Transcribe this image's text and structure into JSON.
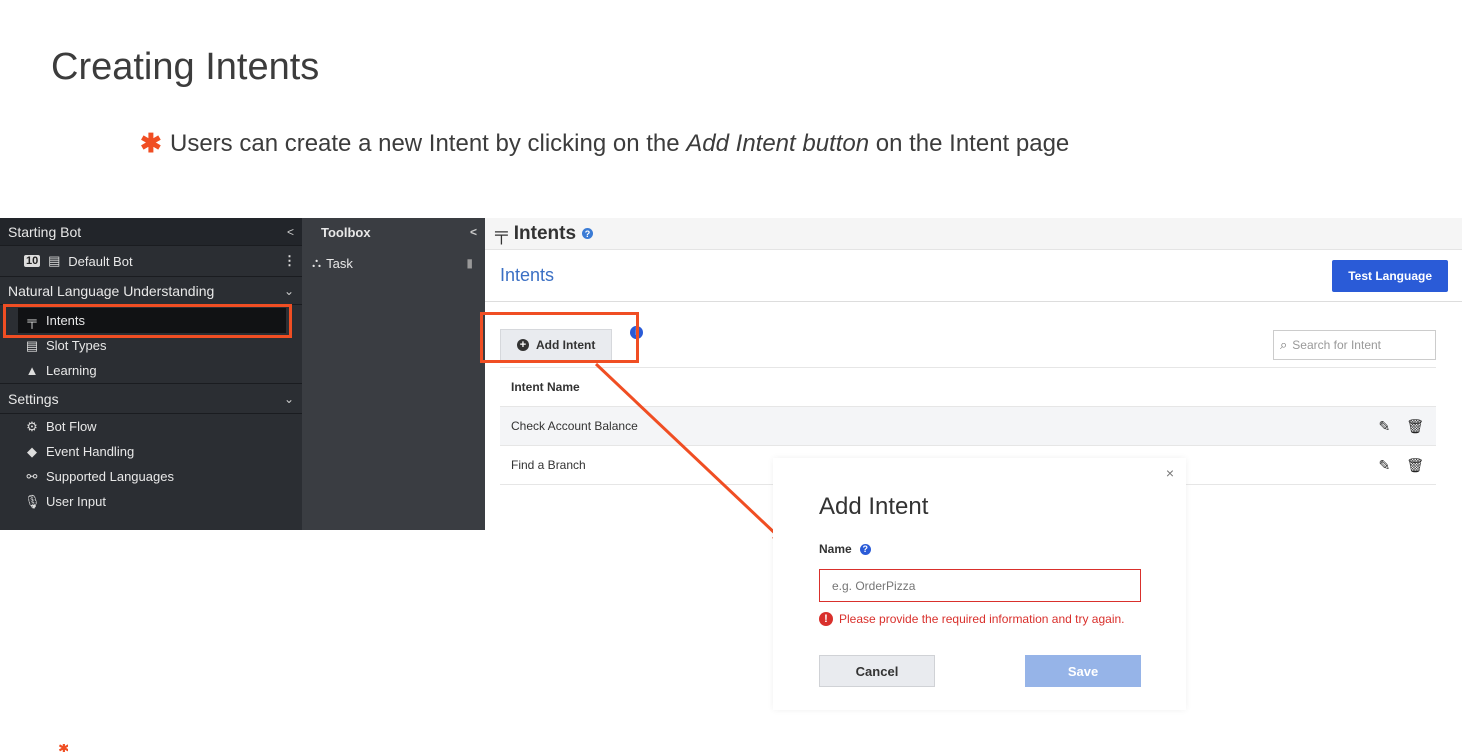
{
  "slide": {
    "title": "Creating Intents",
    "bullet_pre": "Users can create a new Intent by clicking on the ",
    "bullet_em": "Add Intent button",
    "bullet_post": " on the Intent page",
    "bullet_marker": "✱"
  },
  "sidebar": {
    "starting_bot": "Starting Bot",
    "default_bot_badge": "10",
    "default_bot": "Default Bot",
    "nlu_section": "Natural Language Understanding",
    "intents": "Intents",
    "slot_types": "Slot Types",
    "learning": "Learning",
    "settings_section": "Settings",
    "bot_flow": "Bot Flow",
    "event_handling": "Event Handling",
    "supported_languages": "Supported Languages",
    "user_input": "User Input"
  },
  "toolbox": {
    "title": "Toolbox",
    "task": "Task"
  },
  "main": {
    "header": "Intents",
    "subheader": "Intents",
    "test_language": "Test Language",
    "add_intent": "Add Intent",
    "search_placeholder": "Search for Intent",
    "column_intent_name": "Intent Name",
    "rows": [
      "Check Account Balance",
      "Find a Branch"
    ]
  },
  "modal": {
    "title": "Add Intent",
    "name_label": "Name",
    "name_placeholder": "e.g. OrderPizza",
    "error": "Please provide the required information and try again.",
    "cancel": "Cancel",
    "save": "Save"
  },
  "colors": {
    "highlight": "#f04e23",
    "primary": "#2a5bd7",
    "error": "#d9302c"
  }
}
